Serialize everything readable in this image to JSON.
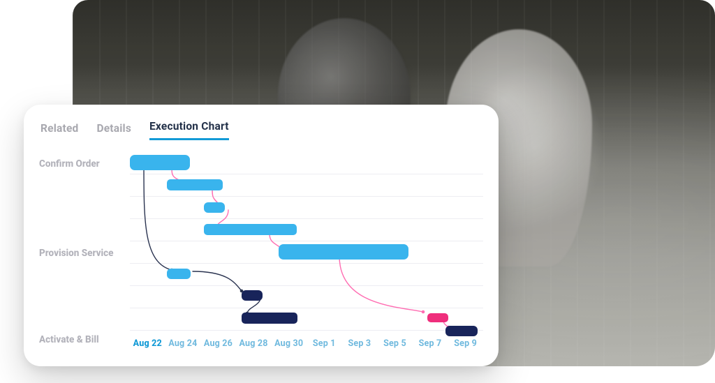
{
  "tabs": {
    "related": "Related",
    "details": "Details",
    "execution": "Execution Chart"
  },
  "rows": {
    "confirm_order": "Confirm Order",
    "provision_service": "Provision Service",
    "activate_bill": "Activate & Bill"
  },
  "xaxis": {
    "ticks": [
      "Aug 22",
      "Aug 24",
      "Aug 26",
      "Aug 28",
      "Aug 30",
      "Sep 1",
      "Sep 3",
      "Sep 5",
      "Sep 7",
      "Sep 9"
    ],
    "current": "Aug 22"
  },
  "chart_data": {
    "type": "gantt",
    "title": "Execution Chart",
    "x_domain": {
      "start": "Aug 22",
      "end": "Sep 10",
      "ticks": [
        "Aug 22",
        "Aug 24",
        "Aug 26",
        "Aug 28",
        "Aug 30",
        "Sep 1",
        "Sep 3",
        "Sep 5",
        "Sep 7",
        "Sep 9"
      ]
    },
    "rows": [
      "Confirm Order",
      "Provision Service",
      "Activate & Bill"
    ],
    "colors": {
      "task": "#39b4ed",
      "milestone_dark": "#18245a",
      "highlight_pink": "#ef2e7c"
    },
    "tasks": [
      {
        "id": "co1",
        "row": "Confirm Order",
        "start": "Aug 22",
        "end": "Aug 25",
        "color": "task"
      },
      {
        "id": "t2",
        "row": 1,
        "start": "Aug 24",
        "end": "Aug 27",
        "color": "task"
      },
      {
        "id": "t3",
        "row": 2,
        "start": "Aug 26",
        "end": "Aug 27",
        "color": "task"
      },
      {
        "id": "t4",
        "row": 3,
        "start": "Aug 26",
        "end": "Aug 31",
        "color": "task"
      },
      {
        "id": "ps1",
        "row": "Provision Service",
        "start": "Aug 30",
        "end": "Sep 6",
        "color": "task"
      },
      {
        "id": "m1",
        "row": 5,
        "start": "Aug 24",
        "end": "Aug 25",
        "color": "task"
      },
      {
        "id": "m2",
        "row": 6,
        "start": "Aug 28",
        "end": "Aug 29",
        "color": "milestone_dark"
      },
      {
        "id": "m3",
        "row": 7,
        "start": "Aug 28",
        "end": "Aug 31",
        "color": "milestone_dark"
      },
      {
        "id": "hp",
        "row": 7,
        "start": "Sep 7",
        "end": "Sep 8",
        "color": "highlight_pink"
      },
      {
        "id": "ab1",
        "row": "Activate & Bill",
        "start": "Sep 8",
        "end": "Sep 10",
        "color": "milestone_dark"
      }
    ],
    "dependencies": [
      {
        "from": "co1",
        "to": "t2",
        "style": "pink"
      },
      {
        "from": "t2",
        "to": "t3",
        "style": "pink"
      },
      {
        "from": "t3",
        "to": "t4",
        "style": "pink"
      },
      {
        "from": "t4",
        "to": "ps1",
        "style": "pink"
      },
      {
        "from": "co1",
        "to": "m1",
        "style": "dark"
      },
      {
        "from": "m1",
        "to": "m2",
        "style": "dark"
      },
      {
        "from": "m2",
        "to": "m3",
        "style": "dark"
      },
      {
        "from": "ps1",
        "to": "hp",
        "style": "pink"
      },
      {
        "from": "hp",
        "to": "ab1",
        "style": "pink"
      }
    ]
  }
}
